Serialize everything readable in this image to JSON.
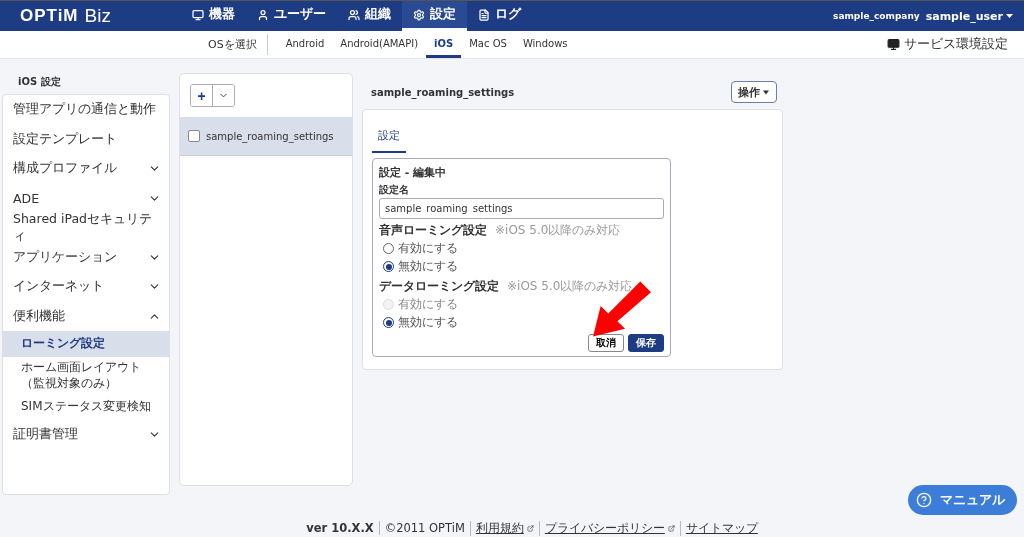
{
  "header": {
    "logo": "OPTiM",
    "logo_suffix": "Biz",
    "nav": [
      {
        "label": "機器",
        "selected": false
      },
      {
        "label": "ユーザー",
        "selected": false
      },
      {
        "label": "組織",
        "selected": false
      },
      {
        "label": "設定",
        "selected": true
      },
      {
        "label": "ログ",
        "selected": false
      }
    ],
    "company": "sample_company",
    "user": "sample_user"
  },
  "os_bar": {
    "label": "OSを選択",
    "tabs": [
      {
        "label": "Android",
        "selected": false
      },
      {
        "label": "Android(AMAPI)",
        "selected": false
      },
      {
        "label": "iOS",
        "selected": true
      },
      {
        "label": "Mac OS",
        "selected": false
      },
      {
        "label": "Windows",
        "selected": false
      }
    ],
    "service_link": "サービス環境設定"
  },
  "sidebar": {
    "title": "iOS 設定",
    "items": [
      {
        "label": "管理アプリの通信と動作"
      },
      {
        "label": "設定テンプレート"
      },
      {
        "label": "構成プロファイル",
        "expanded": false
      },
      {
        "label": "ADE",
        "expanded": false
      },
      {
        "label": "Shared iPadセキュリティ"
      },
      {
        "label": "アプリケーション",
        "expanded": false
      },
      {
        "label": "インターネット",
        "expanded": false
      },
      {
        "label": "便利機能",
        "expanded": true,
        "children": [
          {
            "label": "ローミング設定",
            "selected": true
          },
          {
            "label": "ホーム画面レイアウト（監視対象のみ）",
            "selected": false
          },
          {
            "label": "SIMステータス変更検知",
            "selected": false
          }
        ]
      },
      {
        "label": "証明書管理",
        "expanded": false
      }
    ]
  },
  "list": {
    "add_button": "+",
    "items": [
      {
        "label": "sample_roaming_settings",
        "checked": false,
        "selected": true
      }
    ]
  },
  "detail": {
    "title": "sample_roaming_settings",
    "action_button": "操作",
    "tabs": [
      {
        "label": "設定",
        "selected": true
      }
    ],
    "form": {
      "title": "設定 - 編集中",
      "name_label": "設定名",
      "name_value": "sample_roaming_settings",
      "groups": [
        {
          "label": "音声ローミング設定",
          "note": "※iOS 5.0以降のみ対応",
          "options": [
            {
              "label": "有効にする",
              "selected": false,
              "disabled": false
            },
            {
              "label": "無効にする",
              "selected": true,
              "disabled": false
            }
          ]
        },
        {
          "label": "データローミング設定",
          "note": "※iOS 5.0以降のみ対応",
          "options": [
            {
              "label": "有効にする",
              "selected": false,
              "disabled": true
            },
            {
              "label": "無効にする",
              "selected": true,
              "disabled": false
            }
          ]
        }
      ],
      "cancel": "取消",
      "save": "保存"
    }
  },
  "footer": {
    "version": "ver 10.X.X",
    "copyright": "©2011 OPTiM",
    "links": [
      {
        "label": "利用規約",
        "external": true
      },
      {
        "label": "プライバシーポリシー",
        "external": true
      },
      {
        "label": "サイトマップ",
        "external": false
      }
    ]
  },
  "manual_button": "マニュアル"
}
